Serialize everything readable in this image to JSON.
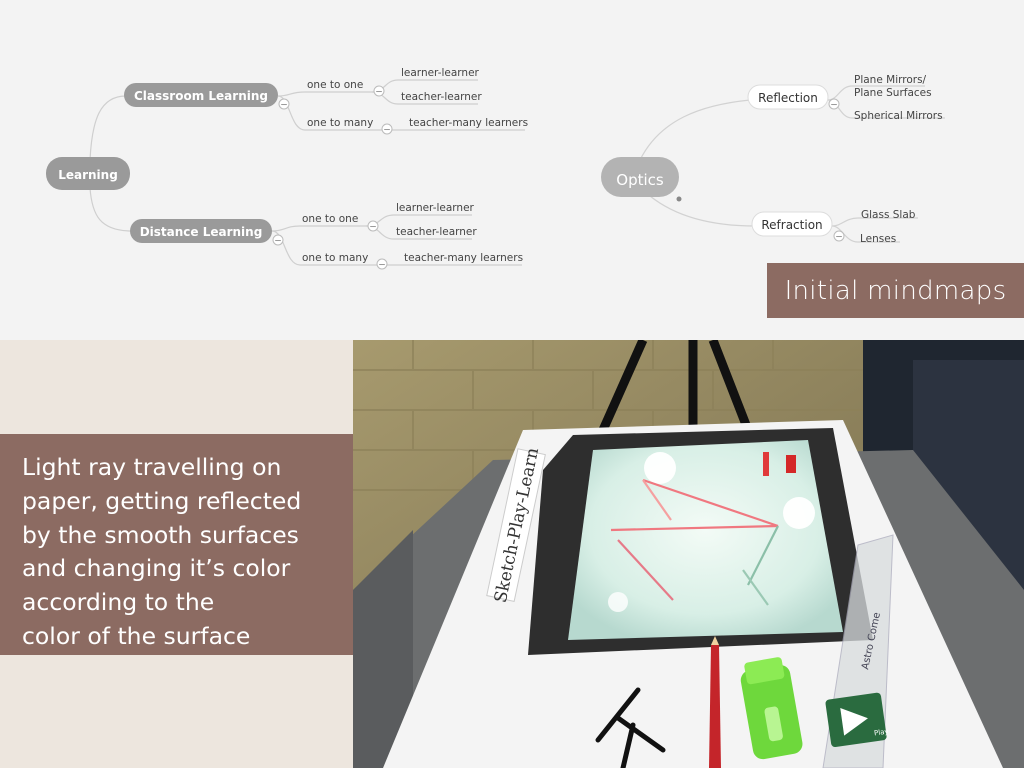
{
  "mindmap_learning": {
    "root": "Learning",
    "branches": [
      {
        "label": "Classroom Learning",
        "modes": [
          {
            "label": "one to one",
            "leaves": [
              "learner-learner",
              "teacher-learner"
            ]
          },
          {
            "label": "one to many",
            "leaves": [
              "teacher-many learners"
            ]
          }
        ]
      },
      {
        "label": "Distance Learning",
        "modes": [
          {
            "label": "one to one",
            "leaves": [
              "learner-learner",
              "teacher-learner"
            ]
          },
          {
            "label": "one to many",
            "leaves": [
              "teacher-many learners"
            ]
          }
        ]
      }
    ]
  },
  "mindmap_optics": {
    "root": "Optics",
    "branches": [
      {
        "label": "Reflection",
        "leaves": [
          "Plane Mirrors/",
          "Plane Surfaces",
          "Spherical Mirrors"
        ]
      },
      {
        "label": "Refraction",
        "leaves": [
          "Glass Slab",
          "Lenses"
        ]
      }
    ]
  },
  "captions": {
    "top": "Initial mindmaps",
    "left_lines": [
      "Light ray travelling on",
      "paper, getting reflected",
      "by the smooth surfaces",
      "and changing it’s color",
      "according to the",
      "color of the surface"
    ]
  },
  "photo": {
    "card_text": "Sketch-Play-Learn",
    "play_label": "Play",
    "ruler_text": "Astro Come"
  },
  "colors": {
    "caption_bg": "#8c6b62",
    "pill_dark": "#9a9a9a",
    "optics_pill": "#b3b3b3",
    "line": "#cfcfcf"
  }
}
